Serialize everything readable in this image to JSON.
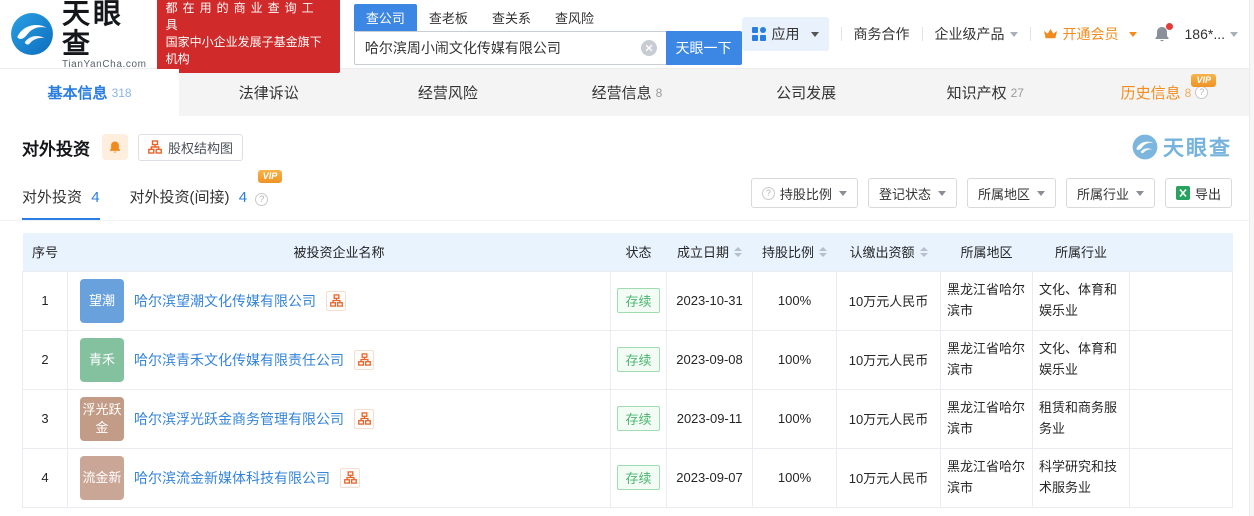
{
  "badges": {
    "vip": "VIP"
  },
  "colors": {
    "primary_blue": "#2a7de1",
    "brand_red": "#d02a2a",
    "vip_orange": "#f08c1e",
    "status_green": "#49b56e",
    "table_header_bg": "#e9f3fd"
  },
  "header": {
    "logo": {
      "name": "天眼查",
      "domain": "TianYanCha.com"
    },
    "slogan": {
      "line1": "都在用的商业查询工具",
      "line2": "国家中小企业发展子基金旗下机构"
    },
    "search": {
      "tabs": [
        {
          "label": "查公司"
        },
        {
          "label": "查老板"
        },
        {
          "label": "查关系"
        },
        {
          "label": "查风险"
        }
      ],
      "value": "哈尔滨周小闹文化传媒有限公司",
      "button": "天眼一下"
    },
    "menu": {
      "apps": "应用",
      "cooperation": "商务合作",
      "enterprise": "企业级产品",
      "vip": "开通会员",
      "phone": "186*..."
    }
  },
  "nav": {
    "tabs": [
      {
        "label": "基本信息",
        "count": "318"
      },
      {
        "label": "法律诉讼"
      },
      {
        "label": "经营风险"
      },
      {
        "label": "经营信息",
        "count": "8"
      },
      {
        "label": "公司发展"
      },
      {
        "label": "知识产权",
        "count": "27"
      },
      {
        "label": "历史信息",
        "count": "8"
      }
    ]
  },
  "section": {
    "title": "对外投资",
    "equity_button": "股权结构图",
    "watermark": "天眼查",
    "subtabs": [
      {
        "label": "对外投资",
        "count": "4"
      },
      {
        "label": "对外投资(间接)",
        "count": "4"
      }
    ],
    "filters": [
      {
        "label": "持股比例"
      },
      {
        "label": "登记状态"
      },
      {
        "label": "所属地区"
      },
      {
        "label": "所属行业"
      }
    ],
    "export_label": "导出"
  },
  "table": {
    "headers": [
      "序号",
      "被投资企业名称",
      "状态",
      "成立日期",
      "持股比例",
      "认缴出资额",
      "所属地区",
      "所属行业",
      ""
    ],
    "rows": [
      {
        "index": "1",
        "avatar": "望潮",
        "avatar_color": "#68a1dc",
        "name": "哈尔滨望潮文化传媒有限公司",
        "status": "存续",
        "date": "2023-10-31",
        "ratio": "100%",
        "amount": "10万元人民币",
        "region": "黑龙江省哈尔滨市",
        "industry": "文化、体育和娱乐业"
      },
      {
        "index": "2",
        "avatar": "青禾",
        "avatar_color": "#84c29f",
        "name": "哈尔滨青禾文化传媒有限责任公司",
        "status": "存续",
        "date": "2023-09-08",
        "ratio": "100%",
        "amount": "10万元人民币",
        "region": "黑龙江省哈尔滨市",
        "industry": "文化、体育和娱乐业"
      },
      {
        "index": "3",
        "avatar": "浮光跃金",
        "avatar_color": "#c29c87",
        "name": "哈尔滨浮光跃金商务管理有限公司",
        "status": "存续",
        "date": "2023-09-11",
        "ratio": "100%",
        "amount": "10万元人民币",
        "region": "黑龙江省哈尔滨市",
        "industry": "租赁和商务服务业"
      },
      {
        "index": "4",
        "avatar": "流金新",
        "avatar_color": "#c9a695",
        "name": "哈尔滨流金新媒体科技有限公司",
        "status": "存续",
        "date": "2023-09-07",
        "ratio": "100%",
        "amount": "10万元人民币",
        "region": "黑龙江省哈尔滨市",
        "industry": "科学研究和技术服务业"
      }
    ]
  }
}
